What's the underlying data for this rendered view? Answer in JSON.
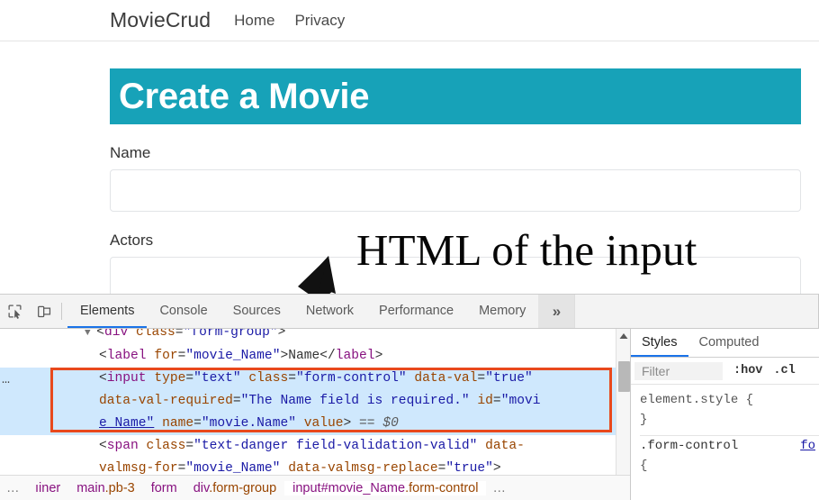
{
  "site": {
    "brand": "MovieCrud",
    "nav": [
      {
        "label": "Home"
      },
      {
        "label": "Privacy"
      }
    ],
    "jumbotron_title": "Create a Movie",
    "fields": [
      {
        "label": "Name",
        "value": ""
      },
      {
        "label": "Actors",
        "value": ""
      }
    ]
  },
  "annotation": {
    "text": "HTML of the input",
    "arrow_icon": "arrow-up-right-icon",
    "color": "#060606"
  },
  "devtools": {
    "toolbar": {
      "inspect_icon": "inspect-element-icon",
      "device_icon": "device-toolbar-icon",
      "tabs": [
        {
          "label": "Elements",
          "active": true
        },
        {
          "label": "Console",
          "active": false
        },
        {
          "label": "Sources",
          "active": false
        },
        {
          "label": "Network",
          "active": false
        },
        {
          "label": "Performance",
          "active": false
        },
        {
          "label": "Memory",
          "active": false
        }
      ],
      "more_label": "»"
    },
    "dom": {
      "left_ellipsis": "…",
      "lines": [
        {
          "id": "line-div-formgroup",
          "parts": [
            {
              "t": "arrowglyph",
              "s": "▼ "
            },
            {
              "t": "punct",
              "s": "<"
            },
            {
              "t": "tag",
              "s": "div"
            },
            {
              "t": "attr",
              "s": " class"
            },
            {
              "t": "punct",
              "s": "="
            },
            {
              "t": "val",
              "s": "\"form-group\""
            },
            {
              "t": "punct",
              "s": ">"
            }
          ]
        },
        {
          "id": "line-label",
          "parts": [
            {
              "t": "punct",
              "s": "<"
            },
            {
              "t": "tag",
              "s": "label"
            },
            {
              "t": "attr",
              "s": " for"
            },
            {
              "t": "punct",
              "s": "="
            },
            {
              "t": "val",
              "s": "\"movie_Name\""
            },
            {
              "t": "punct",
              "s": ">"
            },
            {
              "t": "txt",
              "s": "Name"
            },
            {
              "t": "punct",
              "s": "</"
            },
            {
              "t": "tag",
              "s": "label"
            },
            {
              "t": "punct",
              "s": ">"
            }
          ]
        },
        {
          "id": "line-input-1",
          "parts": [
            {
              "t": "punct",
              "s": "<"
            },
            {
              "t": "tag",
              "s": "input"
            },
            {
              "t": "attr",
              "s": " type"
            },
            {
              "t": "punct",
              "s": "="
            },
            {
              "t": "val",
              "s": "\"text\""
            },
            {
              "t": "attr",
              "s": " class"
            },
            {
              "t": "punct",
              "s": "="
            },
            {
              "t": "val",
              "s": "\"form-control\""
            },
            {
              "t": "attr",
              "s": " data-val"
            },
            {
              "t": "punct",
              "s": "="
            },
            {
              "t": "val",
              "s": "\"true\""
            }
          ]
        },
        {
          "id": "line-input-2",
          "parts": [
            {
              "t": "attr",
              "s": "data-val-required"
            },
            {
              "t": "punct",
              "s": "="
            },
            {
              "t": "val",
              "s": "\"The Name field is required.\""
            },
            {
              "t": "attr",
              "s": " id"
            },
            {
              "t": "punct",
              "s": "="
            },
            {
              "t": "val",
              "s": "\"movi"
            }
          ]
        },
        {
          "id": "line-input-3",
          "parts": [
            {
              "t": "valu",
              "s": "e_Name\""
            },
            {
              "t": "attr",
              "s": " name"
            },
            {
              "t": "punct",
              "s": "="
            },
            {
              "t": "val",
              "s": "\"movie.Name\""
            },
            {
              "t": "attr",
              "s": " value"
            },
            {
              "t": "punct",
              "s": ">"
            },
            {
              "t": "dollar",
              "s": " == $0"
            }
          ]
        },
        {
          "id": "line-span-1",
          "parts": [
            {
              "t": "punct",
              "s": "<"
            },
            {
              "t": "tag",
              "s": "span"
            },
            {
              "t": "attr",
              "s": " class"
            },
            {
              "t": "punct",
              "s": "="
            },
            {
              "t": "val",
              "s": "\"text-danger field-validation-valid\""
            },
            {
              "t": "attr",
              "s": " data-"
            }
          ]
        },
        {
          "id": "line-span-2",
          "parts": [
            {
              "t": "attr",
              "s": "valmsg-for"
            },
            {
              "t": "punct",
              "s": "="
            },
            {
              "t": "val",
              "s": "\"movie_Name\""
            },
            {
              "t": "attr",
              "s": " data-valmsg-replace"
            },
            {
              "t": "punct",
              "s": "="
            },
            {
              "t": "val",
              "s": "\"true\""
            },
            {
              "t": "punct",
              "s": ">"
            }
          ]
        }
      ],
      "highlight_color": "#e8491d",
      "selection_color": "#cfe8fd"
    },
    "styles": {
      "tabs": [
        {
          "label": "Styles",
          "active": true
        },
        {
          "label": "Computed",
          "active": false
        }
      ],
      "filter_placeholder": "Filter",
      "filter_value": "",
      "toggle_hov": ":hov",
      "toggle_cls": ".cl",
      "rules": [
        {
          "selector": "element.style {",
          "source": ""
        },
        {
          "selector": "}",
          "source": ""
        }
      ],
      "rule2_selector": ".form-control",
      "rule2_source": "fo",
      "rule2_open": "{"
    },
    "breadcrumb": {
      "left_ellipsis": "…",
      "right_ellipsis": "…",
      "items": [
        {
          "tag": "ıiner",
          "cls": "",
          "selected": false
        },
        {
          "tag": "main",
          "cls": ".pb-3",
          "selected": false
        },
        {
          "tag": "form",
          "cls": "",
          "selected": false
        },
        {
          "tag": "div",
          "cls": ".form-group",
          "selected": false
        },
        {
          "tag": "input#movie_Name",
          "cls": ".form-control",
          "selected": true
        }
      ]
    }
  },
  "colors": {
    "accent_teal": "#17a2b8",
    "devtools_highlight": "#e8491d",
    "devtools_selection": "#cfe8fd",
    "tab_active": "#1a73e8"
  }
}
